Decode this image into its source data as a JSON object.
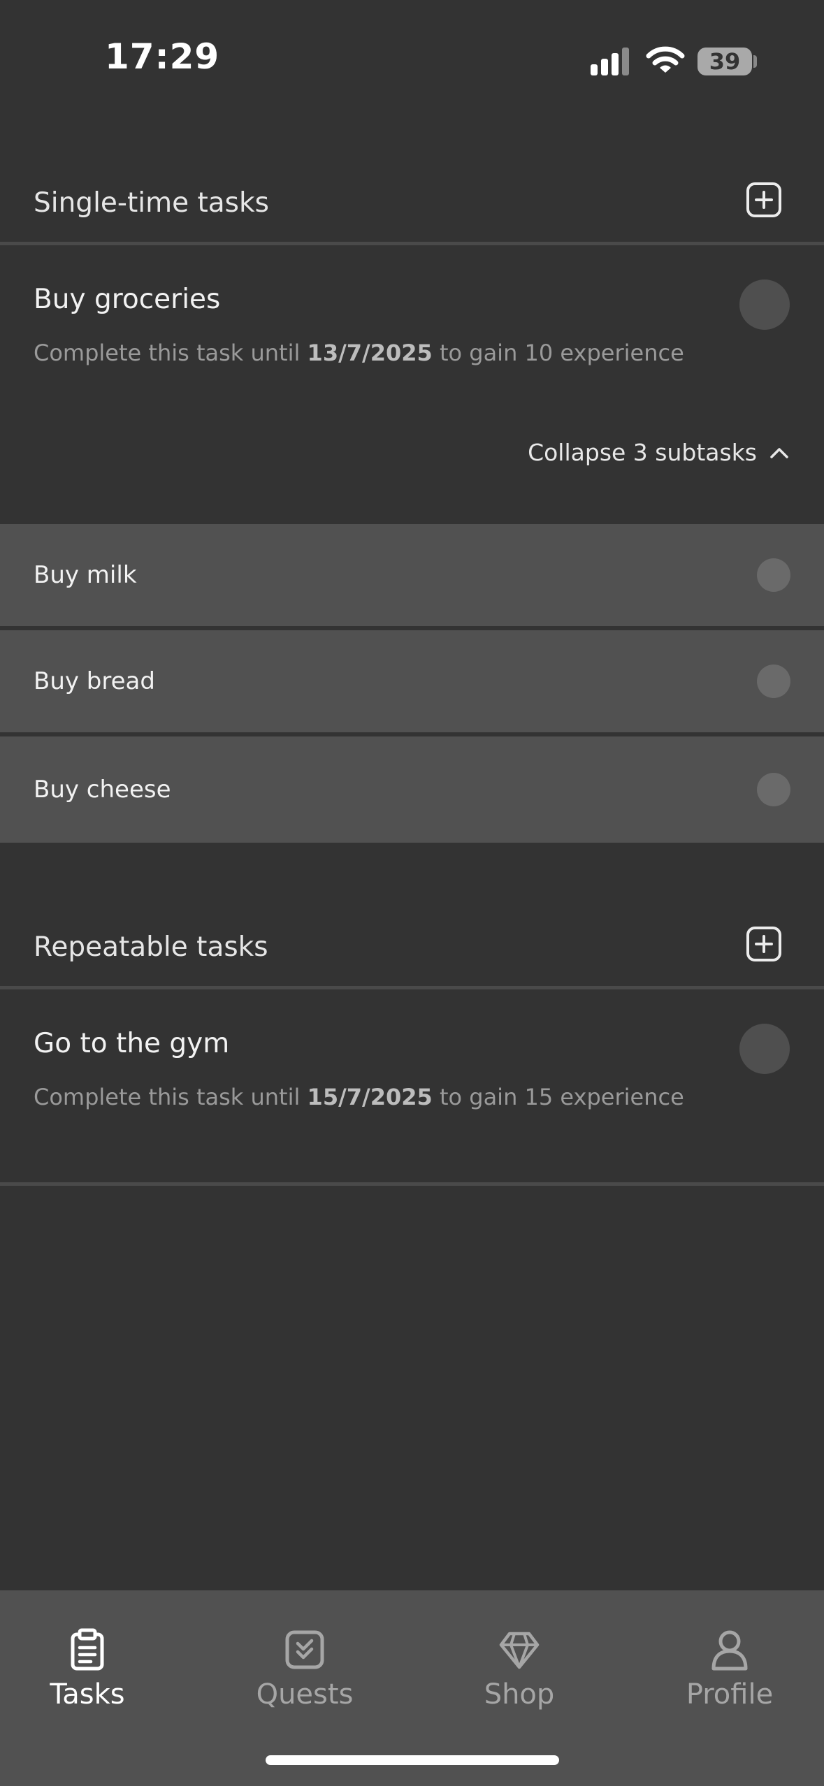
{
  "status_bar": {
    "time": "17:29",
    "battery": "39"
  },
  "sections": [
    {
      "title": "Single-time tasks",
      "add_icon": "plus-square-icon",
      "tasks": [
        {
          "title": "Buy groceries",
          "desc_prefix": "Complete this task until ",
          "desc_date": "13/7/2025",
          "desc_suffix": " to gain 10 experience",
          "collapse_label": "Collapse 3 subtasks",
          "subtasks": [
            {
              "label": "Buy milk"
            },
            {
              "label": "Buy bread"
            },
            {
              "label": "Buy cheese"
            }
          ]
        }
      ]
    },
    {
      "title": "Repeatable tasks",
      "add_icon": "plus-square-icon",
      "tasks": [
        {
          "title": "Go to the gym",
          "desc_prefix": "Complete this task until ",
          "desc_date": "15/7/2025",
          "desc_suffix": " to gain 15 experience"
        }
      ]
    }
  ],
  "nav": [
    {
      "label": "Tasks",
      "icon": "clipboard-icon",
      "active": true
    },
    {
      "label": "Quests",
      "icon": "check-square-icon",
      "active": false
    },
    {
      "label": "Shop",
      "icon": "diamond-icon",
      "active": false
    },
    {
      "label": "Profile",
      "icon": "user-icon",
      "active": false
    }
  ],
  "colors": {
    "background": "#333333",
    "subtask_bg": "#515151",
    "nav_bg": "#515151"
  }
}
